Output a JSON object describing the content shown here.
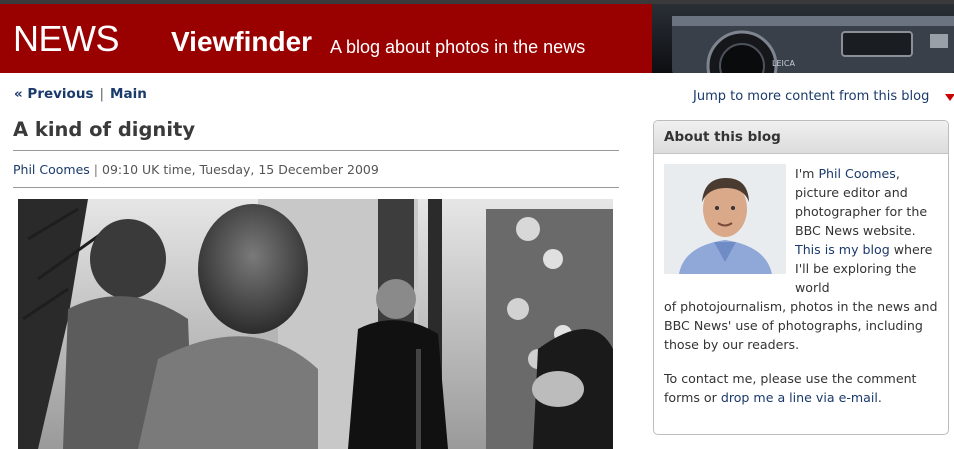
{
  "banner": {
    "brand": "NEWS",
    "blog_name": "Viewfinder",
    "tagline": "A blog about photos in the news"
  },
  "nav": {
    "previous": "« Previous",
    "separator": "|",
    "main": "Main",
    "jump": "Jump to more content from this blog"
  },
  "post": {
    "title": "A kind of dignity",
    "author": "Phil Coomes",
    "separator": "|",
    "timestamp": "09:10 UK time, Tuesday, 15 December 2009"
  },
  "sidebar": {
    "title": "About this blog",
    "intro_1": "I'm ",
    "author_link": "Phil Coomes",
    "intro_2": ", picture editor and photographer for the BBC News website. ",
    "blog_link": "This is my blog",
    "intro_3": " where I'll be exploring the world",
    "intro_4": "of photojournalism, photos in the news and BBC News' use of photographs, including those by our readers.",
    "contact_1": "To contact me, please use the comment forms or ",
    "contact_link": "drop me a line via e-mail",
    "contact_2": "."
  },
  "colors": {
    "banner": "#990000",
    "link": "#1a3a6b",
    "accent_arrow": "#cc0000"
  },
  "icons": {
    "jump_arrow": "triangle-down-icon"
  }
}
